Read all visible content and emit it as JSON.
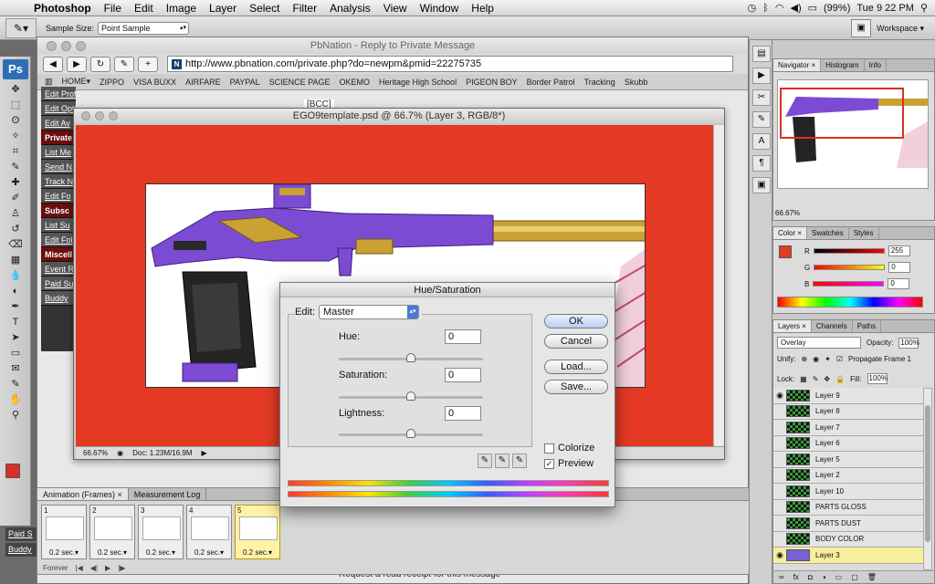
{
  "menubar": {
    "app": "Photoshop",
    "items": [
      "File",
      "Edit",
      "Image",
      "Layer",
      "Select",
      "Filter",
      "Analysis",
      "View",
      "Window",
      "Help"
    ],
    "battery": "(99%)",
    "clock": "Tue 9 22 PM"
  },
  "options": {
    "sample_label": "Sample Size:",
    "sample_value": "Point Sample",
    "workspace": "Workspace ▾"
  },
  "browser": {
    "title": "PbNation - Reply to Private Message",
    "url": "http://www.pbnation.com/private.php?do=newpm&pmid=22275735",
    "bookmarks": [
      "HOME▾",
      "ZIPPO",
      "VISA BUXX",
      "AIRFARE",
      "PAYPAL",
      "SCIENCE PAGE",
      "OKEMO",
      "Heritage High School",
      "PIGEON BOY",
      "Border Patrol",
      "Tracking",
      "Skubb"
    ],
    "sidebar": [
      {
        "label": "Edit Profile",
        "header": false
      },
      {
        "label": "Edit Options",
        "header": false
      },
      {
        "label": "Edit Av",
        "header": false
      },
      {
        "label": "Private",
        "header": true
      },
      {
        "label": "List Me",
        "header": false
      },
      {
        "label": "Send N",
        "header": false
      },
      {
        "label": "Track N",
        "header": false
      },
      {
        "label": "Edit Fo",
        "header": false
      },
      {
        "label": "Subsc",
        "header": true
      },
      {
        "label": "List Su",
        "header": false
      },
      {
        "label": "Edit Fol",
        "header": false
      },
      {
        "label": "Miscell",
        "header": true
      },
      {
        "label": "Event R",
        "header": false
      },
      {
        "label": "Paid Su",
        "header": false
      },
      {
        "label": "Buddy",
        "header": false
      }
    ],
    "bcc": "[BCC]",
    "receipt": "Request a read receipt for this message",
    "left_links": [
      "Paid S",
      "Buddy"
    ]
  },
  "document": {
    "title": "EGO9template.psd @ 66.7% (Layer 3, RGB/8*)",
    "zoom": "66.67%",
    "doc_size": "Doc: 1.23M/16.9M"
  },
  "hue_saturation": {
    "title": "Hue/Saturation",
    "edit_label": "Edit:",
    "edit_value": "Master",
    "hue_label": "Hue:",
    "hue_value": "0",
    "saturation_label": "Saturation:",
    "saturation_value": "0",
    "lightness_label": "Lightness:",
    "lightness_value": "0",
    "ok": "OK",
    "cancel": "Cancel",
    "load": "Load...",
    "save": "Save...",
    "colorize_label": "Colorize",
    "colorize_checked": false,
    "preview_label": "Preview",
    "preview_checked": true
  },
  "animation": {
    "tabs": [
      "Animation (Frames) ×",
      "Measurement Log"
    ],
    "frames": [
      {
        "num": "1",
        "delay": "0.2 sec.▾"
      },
      {
        "num": "2",
        "delay": "0.2 sec.▾"
      },
      {
        "num": "3",
        "delay": "0.2 sec.▾"
      },
      {
        "num": "4",
        "delay": "0.2 sec.▾"
      },
      {
        "num": "5",
        "delay": "0.2 sec.▾"
      }
    ],
    "selected_frame": 5,
    "loop": "Forever"
  },
  "navigator": {
    "tabs": [
      "Navigator ×",
      "Histogram",
      "Info"
    ],
    "zoom": "66.67%"
  },
  "color": {
    "tabs": [
      "Color ×",
      "Swatches",
      "Styles"
    ],
    "r_label": "R",
    "r": "255",
    "g_label": "G",
    "g": "0",
    "b_label": "B",
    "b": "0",
    "fg": "#e43a24"
  },
  "layers": {
    "tabs": [
      "Layers ×",
      "Channels",
      "Paths"
    ],
    "blend_mode": "Overlay",
    "opacity_label": "Opacity:",
    "opacity": "100%",
    "unify_label": "Unify:",
    "propagate_label": "Propagate Frame 1",
    "lock_label": "Lock:",
    "fill_label": "Fill:",
    "fill": "100%",
    "items": [
      {
        "name": "Layer 9",
        "visible": true,
        "selected": false
      },
      {
        "name": "Layer 8",
        "visible": false,
        "selected": false
      },
      {
        "name": "Layer 7",
        "visible": false,
        "selected": false
      },
      {
        "name": "Layer 6",
        "visible": false,
        "selected": false
      },
      {
        "name": "Layer 5",
        "visible": false,
        "selected": false
      },
      {
        "name": "Layer 2",
        "visible": false,
        "selected": false
      },
      {
        "name": "Layer 10",
        "visible": false,
        "selected": false
      },
      {
        "name": "PARTS GLOSS",
        "visible": false,
        "selected": false
      },
      {
        "name": "PARTS DUST",
        "visible": false,
        "selected": false
      },
      {
        "name": "BODY COLOR",
        "visible": false,
        "selected": false
      },
      {
        "name": "Layer 3",
        "visible": true,
        "selected": true
      }
    ]
  }
}
